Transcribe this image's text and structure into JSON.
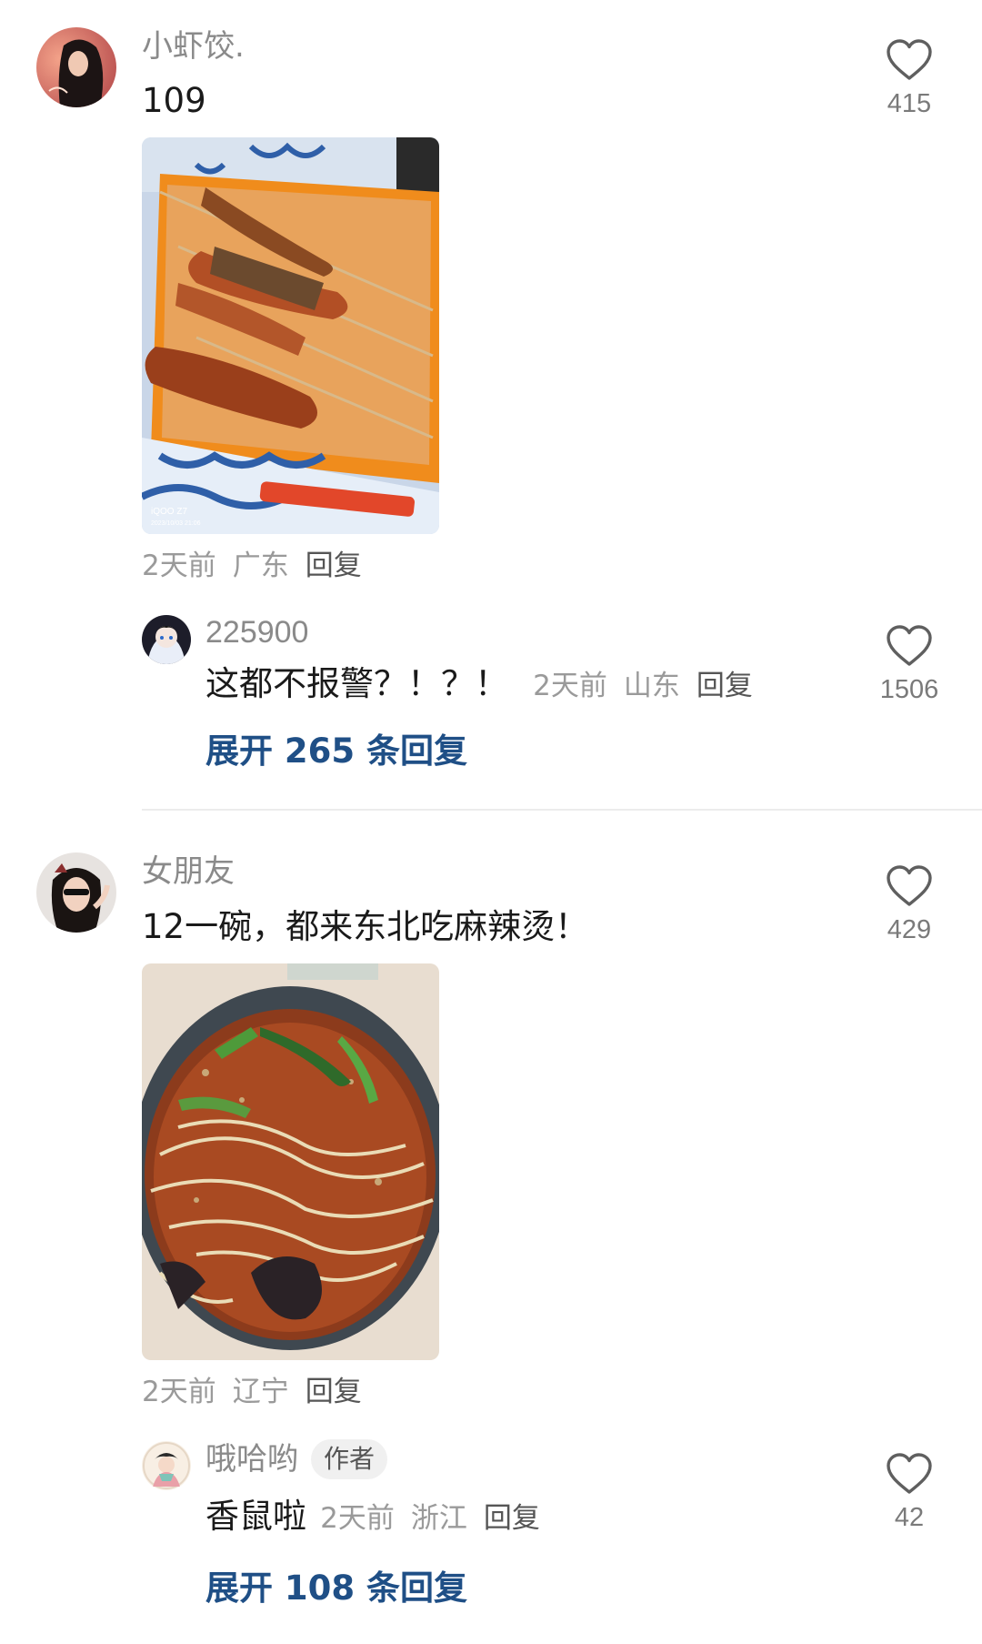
{
  "comments": [
    {
      "user": "小虾饺.",
      "text": "109",
      "meta": {
        "time": "2天前",
        "location": "广东",
        "reply": "回复"
      },
      "likes": "415",
      "reply_thread": {
        "user": "225900",
        "text": "这都不报警？！？！",
        "meta": {
          "time": "2天前",
          "location": "山东",
          "reply": "回复"
        },
        "likes": "1506"
      },
      "expand": "展开 265 条回复"
    },
    {
      "user": "女朋友",
      "text": "12一碗，都来东北吃麻辣烫！",
      "meta": {
        "time": "2天前",
        "location": "辽宁",
        "reply": "回复"
      },
      "likes": "429",
      "reply_thread": {
        "user": "哦哈哟",
        "badge": "作者",
        "text": "香鼠啦",
        "meta": {
          "time": "2天前",
          "location": "浙江",
          "reply": "回复"
        },
        "likes": "42"
      },
      "expand": "展开 108 条回复"
    }
  ],
  "photo_watermark": {
    "brand": "iQOO Z7",
    "stamp": "2023/10/03 21:06"
  },
  "icons": {
    "like": "heart-outline-icon"
  },
  "colors": {
    "expand_link": "#1f4f86",
    "muted": "#8a8a8a"
  }
}
